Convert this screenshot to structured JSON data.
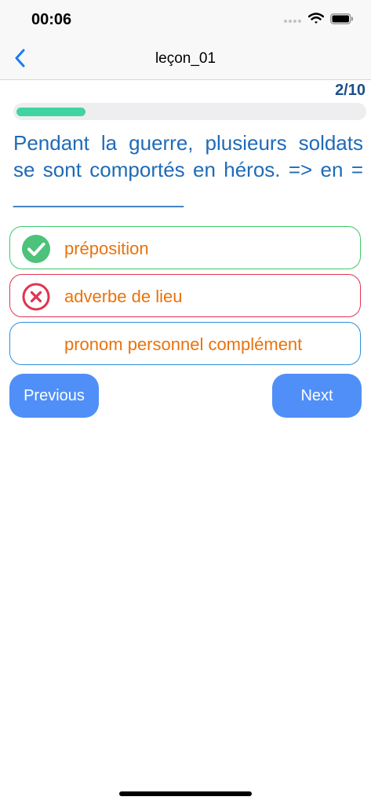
{
  "status_bar": {
    "time": "00:06"
  },
  "nav": {
    "title": "leçon_01",
    "back_icon": "chevron-left-icon"
  },
  "quiz": {
    "counter": "2/10",
    "progress_fraction": 0.2,
    "progress_color": "#3fd4a2",
    "question": "Pendant la guerre, plusieurs soldats se sont comportés en héros. => en = _______________",
    "answers": [
      {
        "label": "préposition",
        "state": "correct",
        "icon": "check-circle-icon",
        "color": "#3cc96b"
      },
      {
        "label": "adverbe de lieu",
        "state": "wrong",
        "icon": "x-circle-icon",
        "color": "#e2334f"
      },
      {
        "label": "pronom personnel complément",
        "state": "neutral",
        "icon": "",
        "color": "#2d8fd8"
      }
    ]
  },
  "buttons": {
    "previous": "Previous",
    "next": "Next"
  },
  "colors": {
    "accent": "#4f8ff7",
    "question_text": "#1f6bb8",
    "answer_text": "#e8730c",
    "counter_text": "#1d4f8a"
  }
}
